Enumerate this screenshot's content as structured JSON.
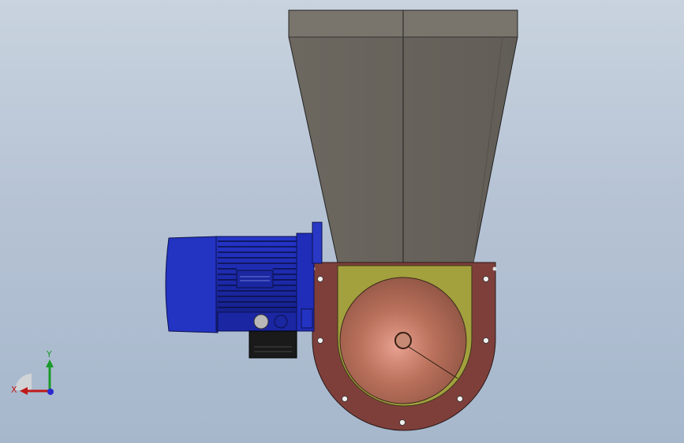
{
  "viewport": {
    "background_top": "#c9d3df",
    "background_bottom": "#a6b7cc"
  },
  "model": {
    "hopper_color": "#6f6b63",
    "motor_color": "#1f2fb3",
    "housing_color": "#7d3f38",
    "flange_color": "#9c9a3c",
    "impeller_color": "#b46a52"
  },
  "triad": {
    "x_label": "X",
    "y_label": "Y",
    "x_color": "#c01818",
    "y_color": "#1a9a2a",
    "z_color": "#2a2ad0"
  }
}
